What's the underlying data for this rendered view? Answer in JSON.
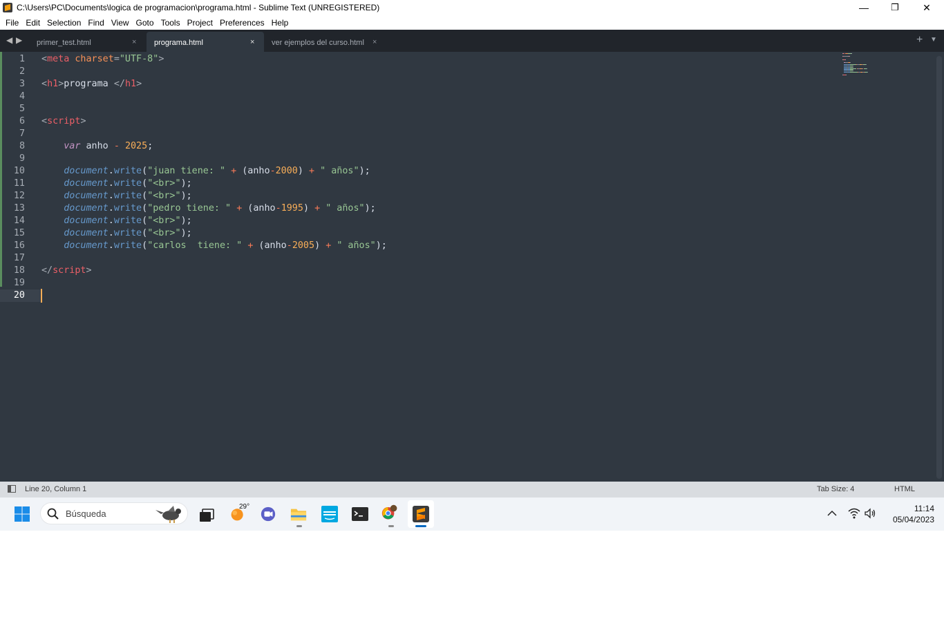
{
  "window": {
    "title": "C:\\Users\\PC\\Documents\\logica de programacion\\programa.html - Sublime Text (UNREGISTERED)",
    "minimize_glyph": "—",
    "restore_glyph": "❐",
    "close_glyph": "✕"
  },
  "menu": [
    "File",
    "Edit",
    "Selection",
    "Find",
    "View",
    "Goto",
    "Tools",
    "Project",
    "Preferences",
    "Help"
  ],
  "tabs": [
    {
      "label": "primer_test.html",
      "active": false,
      "close": "×"
    },
    {
      "label": "programa.html",
      "active": true,
      "close": "×"
    },
    {
      "label": "ver ejemplos del curso.html",
      "active": false,
      "close": "×"
    }
  ],
  "tabbar_controls": {
    "back": "◀",
    "forward": "▶",
    "new_tab": "+",
    "tab_menu": "▼"
  },
  "editor": {
    "current_line": 20,
    "lines": [
      [
        [
          "t-pun",
          "<"
        ],
        [
          "t-el",
          "meta"
        ],
        [
          "t-txt",
          " "
        ],
        [
          "t-attr",
          "charset"
        ],
        [
          "t-pun",
          "="
        ],
        [
          "t-str",
          "\"UTF-8\""
        ],
        [
          "t-pun",
          ">"
        ]
      ],
      [],
      [
        [
          "t-pun",
          "<"
        ],
        [
          "t-el",
          "h1"
        ],
        [
          "t-pun",
          ">"
        ],
        [
          "t-txt",
          "programa "
        ],
        [
          "t-pun",
          "</"
        ],
        [
          "t-el",
          "h1"
        ],
        [
          "t-pun",
          ">"
        ]
      ],
      [],
      [],
      [
        [
          "t-pun",
          "<"
        ],
        [
          "t-el",
          "script"
        ],
        [
          "t-pun",
          ">"
        ]
      ],
      [],
      [
        [
          "t-txt",
          "    "
        ],
        [
          "t-kw",
          "var"
        ],
        [
          "t-txt",
          " anho "
        ],
        [
          "t-op",
          "-"
        ],
        [
          "t-txt",
          " "
        ],
        [
          "t-num",
          "2025"
        ],
        [
          "t-txt",
          ";"
        ]
      ],
      [],
      [
        [
          "t-txt",
          "    "
        ],
        [
          "t-obj",
          "document"
        ],
        [
          "t-txt",
          "."
        ],
        [
          "t-fn",
          "write"
        ],
        [
          "t-txt",
          "("
        ],
        [
          "t-str",
          "\"juan tiene: \""
        ],
        [
          "t-txt",
          " "
        ],
        [
          "t-op",
          "+"
        ],
        [
          "t-txt",
          " (anho"
        ],
        [
          "t-op",
          "-"
        ],
        [
          "t-num",
          "2000"
        ],
        [
          "t-txt",
          ") "
        ],
        [
          "t-op",
          "+"
        ],
        [
          "t-txt",
          " "
        ],
        [
          "t-str",
          "\" años\""
        ],
        [
          "t-txt",
          ");"
        ]
      ],
      [
        [
          "t-txt",
          "    "
        ],
        [
          "t-obj",
          "document"
        ],
        [
          "t-txt",
          "."
        ],
        [
          "t-fn",
          "write"
        ],
        [
          "t-txt",
          "("
        ],
        [
          "t-str",
          "\"<br>\""
        ],
        [
          "t-txt",
          ");"
        ]
      ],
      [
        [
          "t-txt",
          "    "
        ],
        [
          "t-obj",
          "document"
        ],
        [
          "t-txt",
          "."
        ],
        [
          "t-fn",
          "write"
        ],
        [
          "t-txt",
          "("
        ],
        [
          "t-str",
          "\"<br>\""
        ],
        [
          "t-txt",
          ");"
        ]
      ],
      [
        [
          "t-txt",
          "    "
        ],
        [
          "t-obj",
          "document"
        ],
        [
          "t-txt",
          "."
        ],
        [
          "t-fn",
          "write"
        ],
        [
          "t-txt",
          "("
        ],
        [
          "t-str",
          "\"pedro tiene: \""
        ],
        [
          "t-txt",
          " "
        ],
        [
          "t-op",
          "+"
        ],
        [
          "t-txt",
          " (anho"
        ],
        [
          "t-op",
          "-"
        ],
        [
          "t-num",
          "1995"
        ],
        [
          "t-txt",
          ") "
        ],
        [
          "t-op",
          "+"
        ],
        [
          "t-txt",
          " "
        ],
        [
          "t-str",
          "\" años\""
        ],
        [
          "t-txt",
          ");"
        ]
      ],
      [
        [
          "t-txt",
          "    "
        ],
        [
          "t-obj",
          "document"
        ],
        [
          "t-txt",
          "."
        ],
        [
          "t-fn",
          "write"
        ],
        [
          "t-txt",
          "("
        ],
        [
          "t-str",
          "\"<br>\""
        ],
        [
          "t-txt",
          ");"
        ]
      ],
      [
        [
          "t-txt",
          "    "
        ],
        [
          "t-obj",
          "document"
        ],
        [
          "t-txt",
          "."
        ],
        [
          "t-fn",
          "write"
        ],
        [
          "t-txt",
          "("
        ],
        [
          "t-str",
          "\"<br>\""
        ],
        [
          "t-txt",
          ");"
        ]
      ],
      [
        [
          "t-txt",
          "    "
        ],
        [
          "t-obj",
          "document"
        ],
        [
          "t-txt",
          "."
        ],
        [
          "t-fn",
          "write"
        ],
        [
          "t-txt",
          "("
        ],
        [
          "t-str",
          "\"carlos  tiene: \""
        ],
        [
          "t-txt",
          " "
        ],
        [
          "t-op",
          "+"
        ],
        [
          "t-txt",
          " (anho"
        ],
        [
          "t-op",
          "-"
        ],
        [
          "t-num",
          "2005"
        ],
        [
          "t-txt",
          ") "
        ],
        [
          "t-op",
          "+"
        ],
        [
          "t-txt",
          " "
        ],
        [
          "t-str",
          "\" años\""
        ],
        [
          "t-txt",
          ");"
        ]
      ],
      [],
      [
        [
          "t-pun",
          "</"
        ],
        [
          "t-el",
          "script"
        ],
        [
          "t-pun",
          ">"
        ]
      ],
      [],
      []
    ]
  },
  "status": {
    "position": "Line 20, Column 1",
    "tab_size": "Tab Size: 4",
    "syntax": "HTML"
  },
  "taskbar": {
    "search_placeholder": "Búsqueda",
    "weather_temp": "29°",
    "apps": [
      "task-view",
      "weather",
      "teams",
      "file-explorer",
      "prime-video",
      "terminal",
      "chrome",
      "sublime-text"
    ],
    "time": "11:14",
    "date": "05/04/2023"
  },
  "colors": {
    "editor_bg": "#303841",
    "tabbar_bg": "#21252b",
    "caret": "#f9ae58",
    "status_bg": "#d9dce0",
    "taskbar_bg": "#f1f4f8"
  }
}
